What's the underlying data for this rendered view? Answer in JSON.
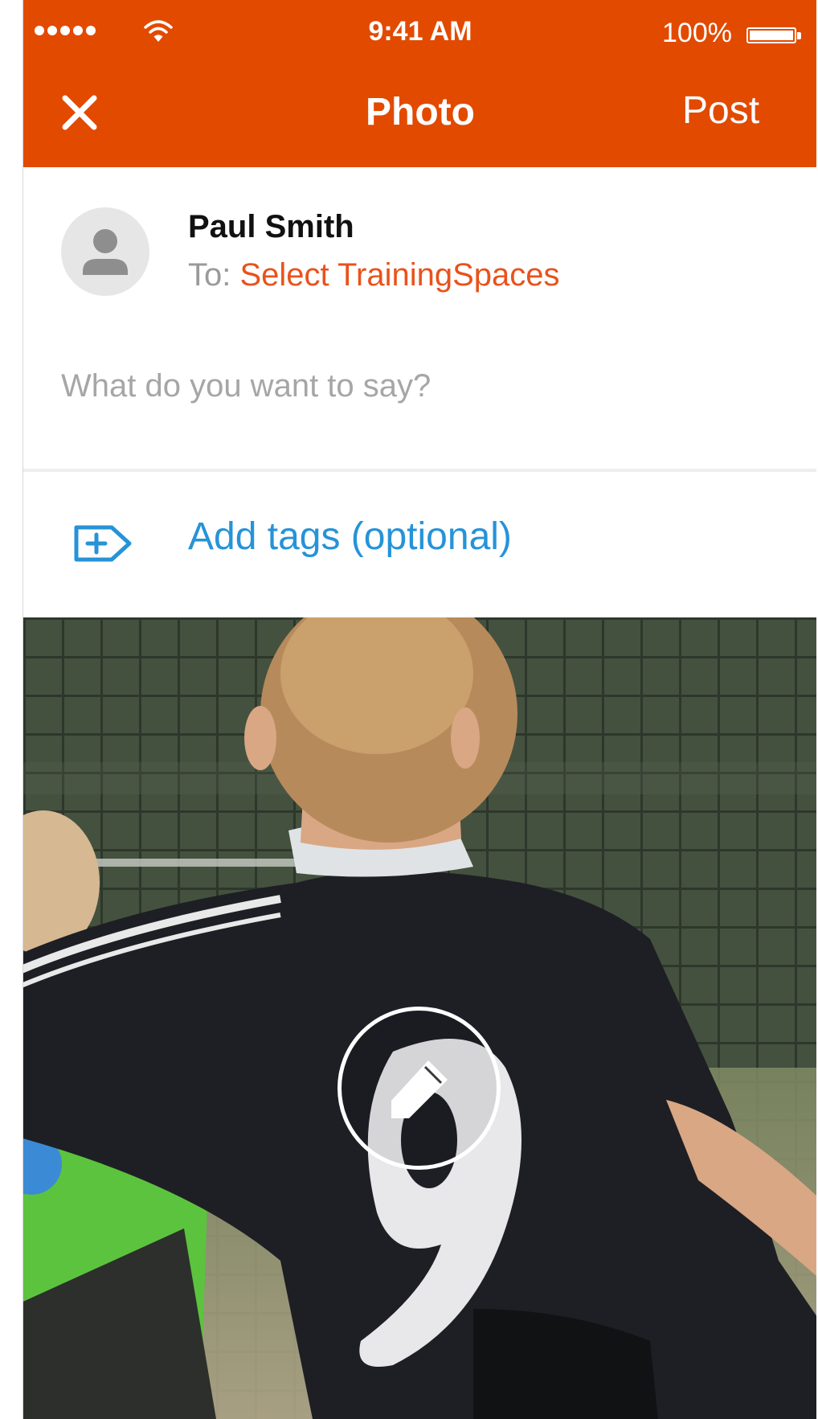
{
  "status_bar": {
    "time": "9:41 AM",
    "battery": "100%"
  },
  "nav": {
    "title": "Photo",
    "post_label": "Post",
    "close_icon": "close-icon"
  },
  "author": {
    "name": "Paul Smith",
    "to_prefix": "To: ",
    "to_link": "Select TrainingSpaces"
  },
  "composer": {
    "placeholder": "What do you want to say?"
  },
  "tags": {
    "label": "Add tags (optional)",
    "icon": "tag-add-icon"
  },
  "photo": {
    "edit_icon": "pencil-icon"
  },
  "colors": {
    "accent": "#e24a00",
    "link_orange": "#e9521c",
    "link_blue": "#2693d8",
    "placeholder": "#a6a6a6"
  }
}
